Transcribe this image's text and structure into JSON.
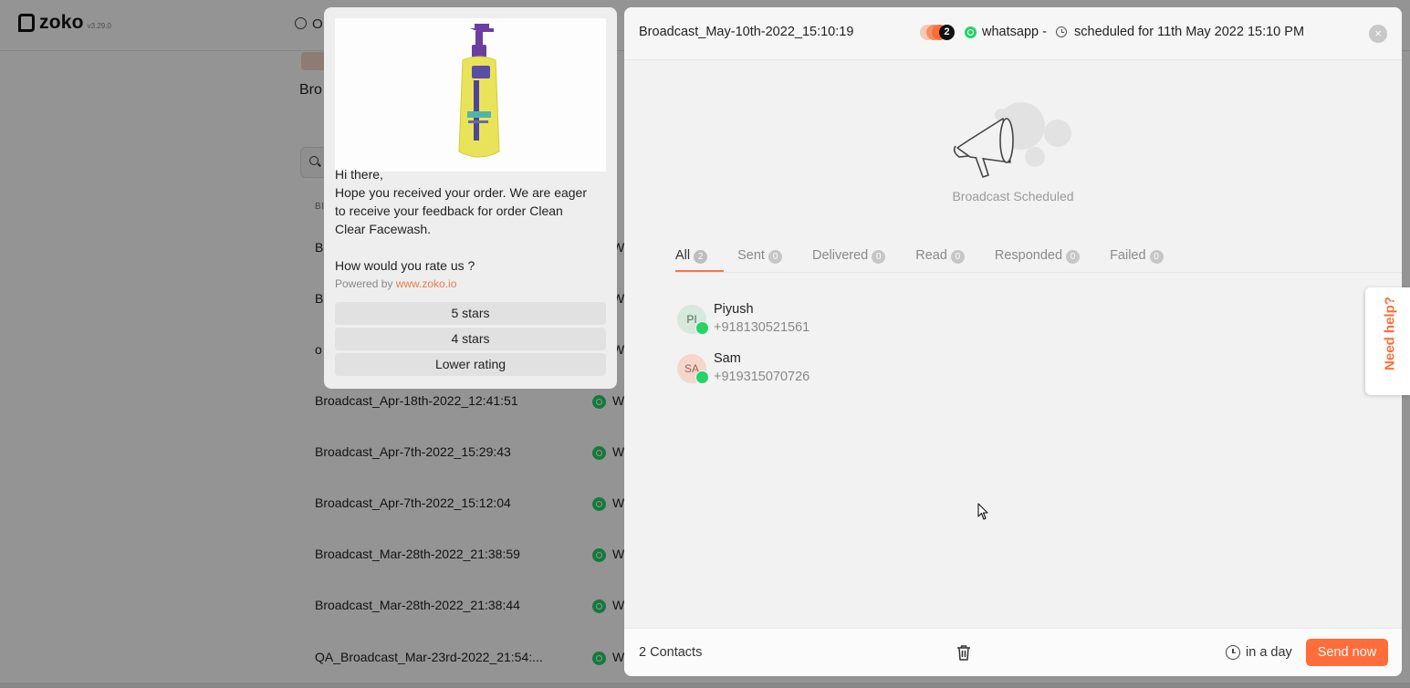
{
  "app": {
    "logo_text": "zoko",
    "version": "v3.29.0",
    "header_fragment": "O",
    "page_heading": "Bro",
    "table_header_fragment": "BI",
    "rows": [
      {
        "name": "B",
        "channel_initial": "W"
      },
      {
        "name": "B",
        "channel_initial": "W"
      },
      {
        "name": "o",
        "channel_initial": "W"
      },
      {
        "name": "Broadcast_Apr-18th-2022_12:41:51",
        "channel_initial": "W"
      },
      {
        "name": "Broadcast_Apr-7th-2022_15:29:43",
        "channel_initial": "W"
      },
      {
        "name": "Broadcast_Apr-7th-2022_15:12:04",
        "channel_initial": "W"
      },
      {
        "name": "Broadcast_Mar-28th-2022_21:38:59",
        "channel_initial": "W"
      },
      {
        "name": "Broadcast_Mar-28th-2022_21:38:44",
        "channel_initial": "W"
      },
      {
        "name": "QA_Broadcast_Mar-23rd-2022_21:54:...",
        "channel_initial": "W"
      }
    ]
  },
  "preview": {
    "image": "facewash-bottle-image",
    "greeting": "Hi there,",
    "body_lines": [
      "Hope you received your order. We are eager",
      "to receive your feedback for order Clean",
      "Clear Facewash."
    ],
    "question": "How would you rate us ?",
    "powered_prefix": "Powered by ",
    "powered_link": "www.zoko.io",
    "buttons": [
      "5 stars",
      "4 stars",
      "Lower rating"
    ]
  },
  "panel": {
    "title": "Broadcast_May-10th-2022_15:10:19",
    "recipient_count": "2",
    "channel": "whatsapp -",
    "scheduled_text": "scheduled for 11th May 2022 15:10 PM",
    "close_icon": "×",
    "empty_caption": "Broadcast Scheduled",
    "tabs": [
      {
        "label": "All",
        "count": "2"
      },
      {
        "label": "Sent",
        "count": "0"
      },
      {
        "label": "Delivered",
        "count": "0"
      },
      {
        "label": "Read",
        "count": "0"
      },
      {
        "label": "Responded",
        "count": "0"
      },
      {
        "label": "Failed",
        "count": "0"
      }
    ],
    "contacts": [
      {
        "initials": "PI",
        "name": "Piyush",
        "phone": "+918130521561"
      },
      {
        "initials": "SA",
        "name": "Sam",
        "phone": "+919315070726"
      }
    ],
    "footer": {
      "contacts_count": "2 Contacts",
      "schedule_label": "in a day",
      "send_button": "Send now"
    }
  },
  "help": {
    "label": "Need help?"
  },
  "colors": {
    "accent": "#ff6d3a",
    "whatsapp": "#25d366",
    "overlay": "rgba(0,0,0,0.42)"
  }
}
